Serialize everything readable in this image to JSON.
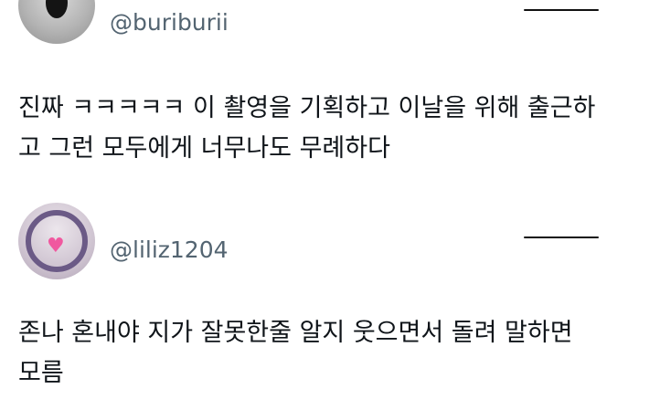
{
  "posts": [
    {
      "handle": "@buriburii",
      "text_lines": [
        "진짜 ㅋㅋㅋㅋㅋ 이 촬영을 기획하고 이날을 위해 출근하",
        "고 그런 모두에게 너무나도 무례하다"
      ]
    },
    {
      "handle": "@liliz1204",
      "text_lines": [
        "존나 혼내야 지가 잘못한줄 알지 웃으면서 돌려 말하면",
        "모름"
      ]
    }
  ],
  "icons": {
    "post_1_avatar": "avatar",
    "post_2_avatar": "avatar",
    "post_2_heart": "heart-icon",
    "more_menu": "more-options-line"
  },
  "colors": {
    "handle": "#536471",
    "text": "#0f1419",
    "heart": "#ec3a86"
  }
}
